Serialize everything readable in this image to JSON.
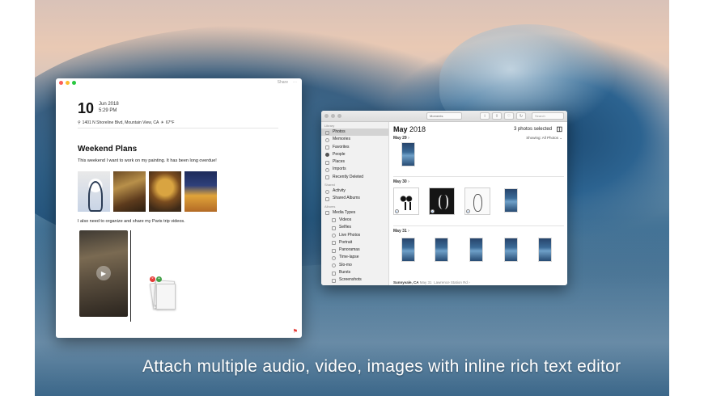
{
  "caption": "Attach multiple audio, video, images with inline rich text editor",
  "editor": {
    "toolbar": {
      "share_label": "Share",
      "more_label": "⋯"
    },
    "date": {
      "day": "10",
      "month_year": "Jun 2018",
      "time": "5:29 PM"
    },
    "location": "1401 N Shoreline Blvd, Mountain View, CA",
    "weather": "67°F",
    "heading": "Weekend Plans",
    "paragraph1": "This weekend I want to work on my painting. It has been long overdue!",
    "paragraph2": "I also need to organize and share my Paris trip videos.",
    "video_play_icon": "▶",
    "drag_badge_remove": "×",
    "drag_badge_add": "+",
    "pin_icon": "⚑"
  },
  "photos": {
    "toolbar": {
      "view_selector": "Moments",
      "search_placeholder": "Search"
    },
    "sidebar": {
      "library_header": "Library",
      "library_items": [
        "Photos",
        "Memories",
        "Favorites",
        "People",
        "Places",
        "Imports",
        "Recently Deleted"
      ],
      "shared_header": "Shared",
      "shared_items": [
        "Activity",
        "Shared Albums"
      ],
      "albums_header": "Albums",
      "albums_group": "Media Types",
      "media_types": [
        "Videos",
        "Selfies",
        "Live Photos",
        "Portrait",
        "Panoramas",
        "Time-lapse",
        "Slo-mo",
        "Bursts",
        "Screenshots"
      ]
    },
    "title_month": "May",
    "title_year": "2018",
    "selected_count": "3 photos selected",
    "showing": "Showing: All Photos ⌄",
    "sections": [
      {
        "label": "May 29",
        "chevron": "›"
      },
      {
        "label": "May 30",
        "chevron": "›"
      },
      {
        "label": "May 31",
        "chevron": "›"
      }
    ],
    "footer_place": "Sunnyvale, CA",
    "footer_date": "May 31",
    "footer_sub": "Lawrence Station Rd",
    "footer_chevron": "›"
  },
  "colors": {
    "accent": "#1a73e8",
    "close": "#fc5f57",
    "minimize": "#fdbc2e",
    "zoom": "#28c840",
    "pin": "#e53935"
  }
}
